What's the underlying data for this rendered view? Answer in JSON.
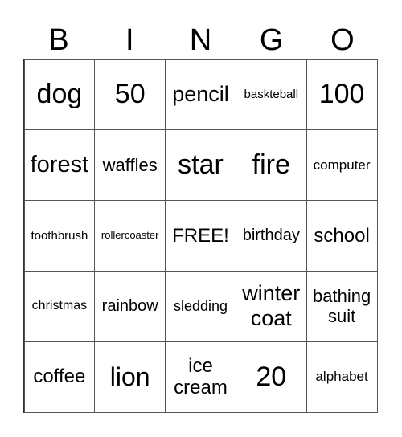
{
  "header": [
    "B",
    "I",
    "N",
    "G",
    "O"
  ],
  "rows": [
    [
      "dog",
      "50",
      "pencil",
      "baskteball",
      "100"
    ],
    [
      "forest",
      "waffles",
      "star",
      "fire",
      "computer"
    ],
    [
      "toothbrush",
      "rollercoaster",
      "FREE!",
      "birthday",
      "school"
    ],
    [
      "christmas",
      "rainbow",
      "sledding",
      "winter coat",
      "bathing suit"
    ],
    [
      "coffee",
      "lion",
      "ice cream",
      "20",
      "alphabet"
    ]
  ]
}
